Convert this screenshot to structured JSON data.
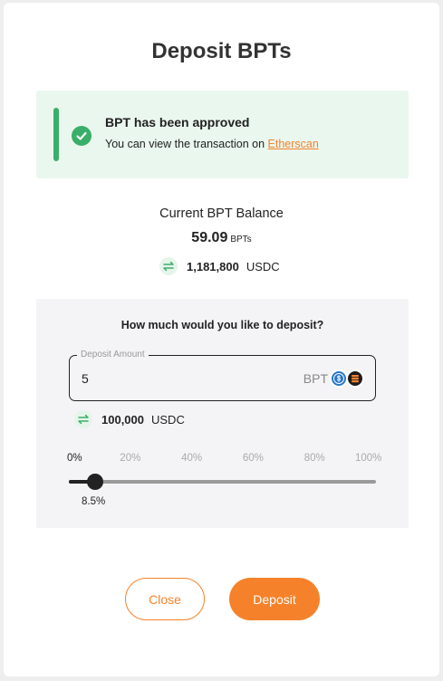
{
  "modal": {
    "title": "Deposit BPTs"
  },
  "alert": {
    "title": "BPT has been approved",
    "text_prefix": "You can view the transaction on ",
    "link_label": "Etherscan",
    "icon": "check-circle-icon",
    "accent_color": "#3aaf6a"
  },
  "balance": {
    "label": "Current BPT Balance",
    "value": "59.09",
    "unit": "BPTs",
    "converted_value": "1,181,800",
    "converted_unit": "USDC",
    "conversion_icon": "swap-arrows-icon"
  },
  "deposit": {
    "question": "How much would you like to deposit?",
    "field_label": "Deposit Amount",
    "field_value": "5",
    "field_unit": "BPT",
    "token_icons": [
      "usdc-token-icon",
      "bpt-token-icon"
    ],
    "converted_value": "100,000",
    "converted_unit": "USDC"
  },
  "slider": {
    "marks": [
      "0%",
      "20%",
      "40%",
      "60%",
      "80%",
      "100%"
    ],
    "active_mark": 0,
    "value": 8.5,
    "value_label": "8.5%"
  },
  "buttons": {
    "close_label": "Close",
    "deposit_label": "Deposit"
  },
  "colors": {
    "accent": "#f5822a",
    "success": "#3aaf6a",
    "panel": "#f4f4f7"
  }
}
